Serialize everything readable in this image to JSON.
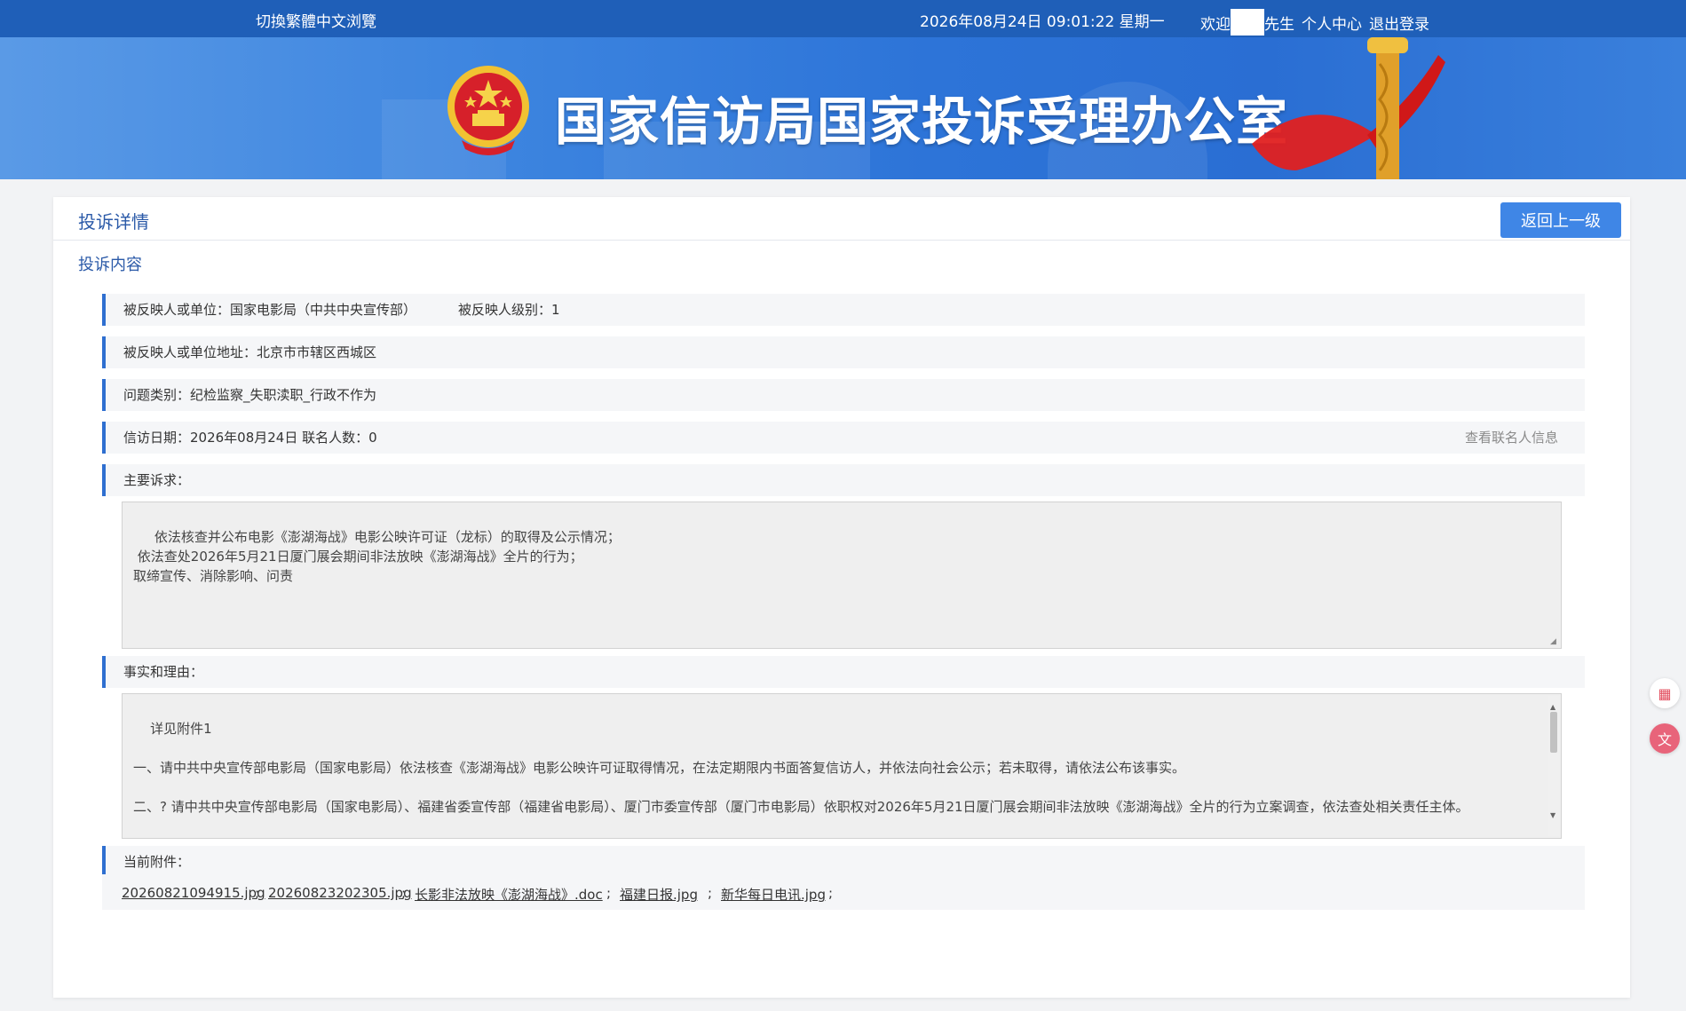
{
  "topbar": {
    "lang_switch": "切換繁體中文浏覽",
    "datetime": "2026年08月24日  09:01:22  星期一",
    "welcome_prefix": "欢迎",
    "welcome_suffix": "先生",
    "personal_center": "个人中心",
    "logout": "退出登录"
  },
  "banner": {
    "title": "国家信访局国家投诉受理办公室"
  },
  "card": {
    "title": "投诉详情",
    "back_button": "返回上一级",
    "section_title": "投诉内容"
  },
  "fields": {
    "respondent": "被反映人或单位：国家电影局（中共中央宣传部）",
    "respondent_level": "被反映人级别：1",
    "respondent_address": "被反映人或单位地址：北京市市辖区西城区",
    "problem_type": "问题类别：纪检监察_失职渎职_行政不作为",
    "date_and_count": "信访日期：2026年08月24日  联名人数：0",
    "view_cosigners": "查看联名人信息",
    "main_claim_label": "主要诉求：",
    "main_claim_text": " 依法核查并公布电影《澎湖海战》电影公映许可证（龙标）的取得及公示情况；\n 依法查处2026年5月21日厦门展会期间非法放映《澎湖海战》全片的行为；\n取缔宣传、消除影响、问责",
    "facts_label": "事实和理由：",
    "facts_text": "详见附件1\n\n一、请中共中央宣传部电影局（国家电影局）依法核查《澎湖海战》电影公映许可证取得情况，在法定期限内书面答复信访人，并依法向社会公示；若未取得，请依法公布该事实。\n\n二、? 请中共中央宣传部电影局（国家电影局）、福建省委宣传部（福建省电影局）、厦门市委宣传部（厦门市电影局）依职权对2026年5月21日厦门展会期间非法放映《澎湖海战》全片的行为立案调查，依法查处相关责任主体。\n\n三、? 请中共中央宣传部电影局（国家电影局）、吉林省委宣传部（吉林省电影局）依职权对长影集团发布该片预告片、海报的行为进行调查，责令停止传播并清除已发布的违法违规视听节目。",
    "attachments_label": "当前附件：",
    "attachments": [
      "20260821094915.jpg",
      "20260823202305.jpg",
      "长影非法放映《澎湖海战》.doc",
      "福建日报.jpg",
      "新华每日电讯.jpg"
    ],
    "attachment_sep": ";"
  },
  "colors": {
    "topbar": "#1f5fb8",
    "accent": "#2f6fd0",
    "button": "#3f86e6"
  }
}
